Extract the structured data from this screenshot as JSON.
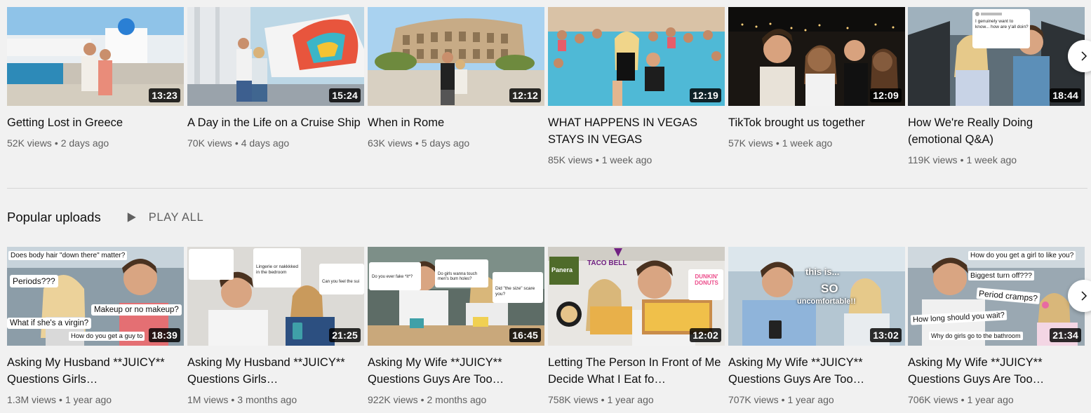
{
  "shelf1": {
    "videos": [
      {
        "title": "Getting Lost in Greece",
        "views": "52K views",
        "age": "2 days ago",
        "duration": "13:23"
      },
      {
        "title": "A Day in the Life on a Cruise Ship",
        "views": "70K views",
        "age": "4 days ago",
        "duration": "15:24"
      },
      {
        "title": "When in Rome",
        "views": "63K views",
        "age": "5 days ago",
        "duration": "12:12"
      },
      {
        "title": "WHAT HAPPENS IN VEGAS STAYS IN VEGAS",
        "views": "85K views",
        "age": "1 week ago",
        "duration": "12:19"
      },
      {
        "title": "TikTok brought us together",
        "views": "57K views",
        "age": "1 week ago",
        "duration": "12:09"
      },
      {
        "title": "How We're Really Doing (emotional Q&A)",
        "views": "119K views",
        "age": "1 week ago",
        "duration": "18:44"
      }
    ]
  },
  "popular": {
    "title": "Popular uploads",
    "play_all": "PLAY ALL",
    "videos": [
      {
        "title": "Asking My Husband **JUICY** Questions Girls…",
        "views": "1.3M views",
        "age": "1 year ago",
        "duration": "18:39"
      },
      {
        "title": "Asking My Husband **JUICY** Questions Girls…",
        "views": "1M views",
        "age": "3 months ago",
        "duration": "21:25"
      },
      {
        "title": "Asking My Wife **JUICY** Questions Guys Are Too…",
        "views": "922K views",
        "age": "2 months ago",
        "duration": "16:45"
      },
      {
        "title": "Letting The Person In Front of Me Decide What I Eat fo…",
        "views": "758K views",
        "age": "1 year ago",
        "duration": "12:02"
      },
      {
        "title": "Asking My Wife **JUICY** Questions Guys Are Too…",
        "views": "707K views",
        "age": "1 year ago",
        "duration": "13:02"
      },
      {
        "title": "Asking My Wife **JUICY** Questions Guys Are Too…",
        "views": "706K views",
        "age": "1 year ago",
        "duration": "21:34"
      }
    ]
  },
  "thumb_text": {
    "t1_1": "Does body hair \"down there\" matter?",
    "t1_2": "Periods???",
    "t1_3": "Makeup or no makeup?",
    "t1_4": "What if she's a virgin?",
    "t1_5": "How do you get a guy to",
    "t2_1": "Lingerie or nakkkked in the bedroom",
    "t2_2": "Can you feel the sui",
    "t3_1": "Do girls wanna touch men's bum holes?",
    "t3_2": "Do you ever fake *it*?",
    "t3_3": "Did \"the size\" scare you?",
    "t4_1": "TACO BELL",
    "t4_2": "DUNKIN' DONUTS",
    "t4_3": "Panera",
    "t5_1": "this is...",
    "t5_2": "SO",
    "t5_3": "uncomfortable!!",
    "t6_1": "How do you get a girl to like you?",
    "t6_2": "Biggest turn off???",
    "t6_3": "Period cramps?",
    "t6_4": "How long should you wait?",
    "t6_5": "Why do girls go to the bathroom",
    "s6_1": "I genuinely want to know... how are y'all doin?"
  },
  "icons": {
    "next": "chevron-right-icon",
    "play": "play-icon"
  },
  "colors": {
    "background": "#f1f1f1",
    "text_primary": "#0f0f0f",
    "text_secondary": "#606060",
    "duration_bg": "#000000"
  }
}
